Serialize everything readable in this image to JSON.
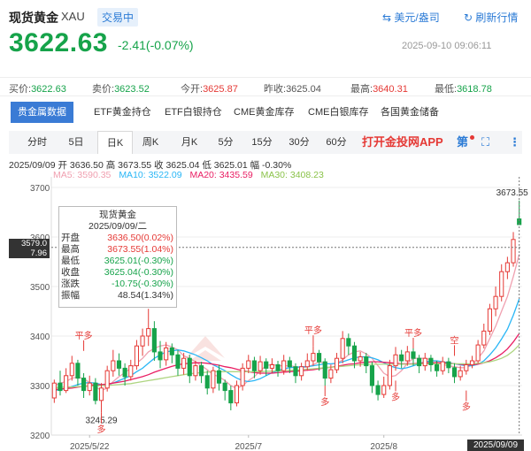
{
  "header": {
    "name": "现货黄金",
    "code": "XAU",
    "state": "交易中",
    "unit_toggle": "美元/盎司",
    "refresh": "刷新行情"
  },
  "price": {
    "last": "3622.63",
    "change": "-2.41(-0.07%)",
    "timestamp": "2025-09-10 09:06:11"
  },
  "quotes": {
    "buy_label": "买价:",
    "buy": "3622.63",
    "sell_label": "卖价:",
    "sell": "3623.52",
    "open_label": "今开:",
    "open": "3625.87",
    "prev_label": "昨收:",
    "prev": "3625.04",
    "high_label": "最高:",
    "high": "3640.31",
    "low_label": "最低:",
    "low": "3618.78"
  },
  "subtabs": [
    "贵金属数据",
    "ETF黄金持仓",
    "ETF白银持仓",
    "CME黄金库存",
    "CME白银库存",
    "各国黄金储备"
  ],
  "periods": [
    "分时",
    "5日",
    "日K",
    "周K",
    "月K",
    "5分",
    "15分",
    "30分",
    "60分"
  ],
  "app_promo": "打开金投网APP",
  "toolbar": {
    "indicator": "第"
  },
  "ohlc_line": "2025/09/09 开 3636.50 高 3673.55 收 3625.04 低 3625.01 幅 -0.30%",
  "ma_line": [
    {
      "label": "MA5: 3590.35",
      "color": "#f0a0b0"
    },
    {
      "label": "MA10: 3522.09",
      "color": "#29b6f6"
    },
    {
      "label": "MA20: 3435.59",
      "color": "#e91e63"
    },
    {
      "label": "MA30: 3408.23",
      "color": "#aed581"
    }
  ],
  "tooltip": {
    "title": "现货黄金",
    "date": "2025/09/09/二",
    "rows": [
      {
        "k": "开盘",
        "v": "3636.50(0.02%)",
        "color": "#e53935"
      },
      {
        "k": "最高",
        "v": "3673.55(1.04%)",
        "color": "#e53935"
      },
      {
        "k": "最低",
        "v": "3625.01(-0.30%)",
        "color": "#16a34a"
      },
      {
        "k": "收盘",
        "v": "3625.04(-0.30%)",
        "color": "#16a34a"
      },
      {
        "k": "涨跌",
        "v": "-10.75(-0.30%)",
        "color": "#16a34a"
      },
      {
        "k": "振幅",
        "v": "48.54(1.34%)",
        "color": "#333333"
      }
    ]
  },
  "crosshair": {
    "price_tag": "3579.0",
    "price_tag2": "7.96",
    "date_tag": "2025/09/09"
  },
  "chart_data": {
    "type": "candlestick",
    "ylim": [
      3200,
      3700
    ],
    "yticks": [
      3200,
      3300,
      3400,
      3500,
      3600,
      3700
    ],
    "xtick_labels": [
      {
        "label": "2025/5/22",
        "index": 6
      },
      {
        "label": "2025/7",
        "index": 33
      },
      {
        "label": "2025/8",
        "index": 56
      }
    ],
    "annotations": [
      {
        "text": "3673.55",
        "index": 79,
        "value": 3673.55
      },
      {
        "text": "3245.29",
        "index": 8,
        "value": 3245.29
      },
      {
        "text": "平多",
        "index": 5,
        "value": 3370
      },
      {
        "text": "多",
        "index": 8,
        "value": 3245
      },
      {
        "text": "平多",
        "index": 44,
        "value": 3380
      },
      {
        "text": "多",
        "index": 46,
        "value": 3300
      },
      {
        "text": "平多",
        "index": 61,
        "value": 3375
      },
      {
        "text": "多",
        "index": 58,
        "value": 3310
      },
      {
        "text": "空",
        "index": 68,
        "value": 3360
      },
      {
        "text": "多",
        "index": 70,
        "value": 3290
      }
    ],
    "candles": [
      [
        3275,
        3305,
        3265,
        3312
      ],
      [
        3305,
        3290,
        3280,
        3330
      ],
      [
        3290,
        3320,
        3285,
        3335
      ],
      [
        3320,
        3345,
        3310,
        3360
      ],
      [
        3345,
        3315,
        3300,
        3352
      ],
      [
        3315,
        3290,
        3275,
        3325
      ],
      [
        3290,
        3305,
        3280,
        3320
      ],
      [
        3305,
        3270,
        3262,
        3315
      ],
      [
        3270,
        3295,
        3245,
        3305
      ],
      [
        3295,
        3330,
        3288,
        3340
      ],
      [
        3330,
        3350,
        3318,
        3372
      ],
      [
        3350,
        3335,
        3320,
        3365
      ],
      [
        3335,
        3318,
        3300,
        3345
      ],
      [
        3318,
        3340,
        3310,
        3352
      ],
      [
        3340,
        3380,
        3332,
        3392
      ],
      [
        3380,
        3400,
        3360,
        3415
      ],
      [
        3400,
        3415,
        3380,
        3455
      ],
      [
        3415,
        3368,
        3350,
        3430
      ],
      [
        3368,
        3352,
        3335,
        3390
      ],
      [
        3352,
        3376,
        3340,
        3388
      ],
      [
        3376,
        3362,
        3345,
        3385
      ],
      [
        3362,
        3335,
        3320,
        3372
      ],
      [
        3335,
        3355,
        3322,
        3366
      ],
      [
        3355,
        3320,
        3305,
        3362
      ],
      [
        3320,
        3340,
        3310,
        3350
      ],
      [
        3340,
        3320,
        3305,
        3348
      ],
      [
        3320,
        3295,
        3282,
        3330
      ],
      [
        3295,
        3330,
        3285,
        3338
      ],
      [
        3330,
        3305,
        3290,
        3342
      ],
      [
        3305,
        3290,
        3270,
        3312
      ],
      [
        3290,
        3265,
        3250,
        3300
      ],
      [
        3265,
        3300,
        3258,
        3310
      ],
      [
        3300,
        3335,
        3290,
        3345
      ],
      [
        3335,
        3350,
        3325,
        3362
      ],
      [
        3350,
        3330,
        3315,
        3358
      ],
      [
        3330,
        3348,
        3322,
        3360
      ],
      [
        3348,
        3335,
        3320,
        3355
      ],
      [
        3335,
        3342,
        3325,
        3355
      ],
      [
        3342,
        3330,
        3318,
        3350
      ],
      [
        3330,
        3350,
        3322,
        3362
      ],
      [
        3350,
        3338,
        3325,
        3358
      ],
      [
        3338,
        3320,
        3305,
        3345
      ],
      [
        3320,
        3338,
        3310,
        3346
      ],
      [
        3338,
        3350,
        3330,
        3365
      ],
      [
        3350,
        3365,
        3340,
        3380
      ],
      [
        3365,
        3348,
        3330,
        3372
      ],
      [
        3348,
        3315,
        3300,
        3355
      ],
      [
        3315,
        3332,
        3305,
        3342
      ],
      [
        3332,
        3355,
        3325,
        3366
      ],
      [
        3355,
        3395,
        3345,
        3410
      ],
      [
        3395,
        3380,
        3362,
        3405
      ],
      [
        3380,
        3350,
        3335,
        3388
      ],
      [
        3350,
        3358,
        3338,
        3368
      ],
      [
        3358,
        3340,
        3325,
        3366
      ],
      [
        3340,
        3300,
        3285,
        3348
      ],
      [
        3300,
        3282,
        3270,
        3310
      ],
      [
        3282,
        3300,
        3275,
        3318
      ],
      [
        3300,
        3340,
        3292,
        3352
      ],
      [
        3340,
        3362,
        3330,
        3378
      ],
      [
        3362,
        3350,
        3335,
        3372
      ],
      [
        3350,
        3368,
        3340,
        3380
      ],
      [
        3368,
        3355,
        3340,
        3376
      ],
      [
        3355,
        3340,
        3325,
        3362
      ],
      [
        3340,
        3355,
        3330,
        3366
      ],
      [
        3355,
        3342,
        3328,
        3362
      ],
      [
        3342,
        3330,
        3318,
        3350
      ],
      [
        3330,
        3348,
        3322,
        3358
      ],
      [
        3348,
        3336,
        3325,
        3356
      ],
      [
        3336,
        3318,
        3305,
        3345
      ],
      [
        3318,
        3330,
        3310,
        3340
      ],
      [
        3330,
        3342,
        3322,
        3352
      ],
      [
        3342,
        3350,
        3335,
        3360
      ],
      [
        3350,
        3382,
        3345,
        3392
      ],
      [
        3382,
        3410,
        3375,
        3425
      ],
      [
        3410,
        3455,
        3402,
        3465
      ],
      [
        3455,
        3480,
        3440,
        3500
      ],
      [
        3480,
        3530,
        3470,
        3545
      ],
      [
        3530,
        3548,
        3515,
        3560
      ],
      [
        3548,
        3595,
        3540,
        3610
      ],
      [
        3636.5,
        3625.04,
        3625.01,
        3673.55
      ]
    ],
    "ma_series": [
      {
        "name": "MA5",
        "color": "#f0a0b0",
        "values": [
          3300,
          3305,
          3308,
          3315,
          3317,
          3314,
          3306,
          3298,
          3290,
          3295,
          3308,
          3318,
          3326,
          3335,
          3345,
          3355,
          3368,
          3375,
          3380,
          3382,
          3378,
          3372,
          3360,
          3355,
          3348,
          3340,
          3332,
          3322,
          3318,
          3310,
          3300,
          3294,
          3300,
          3310,
          3318,
          3330,
          3340,
          3343,
          3340,
          3340,
          3340,
          3338,
          3336,
          3338,
          3342,
          3348,
          3345,
          3343,
          3345,
          3352,
          3362,
          3368,
          3370,
          3364,
          3355,
          3340,
          3325,
          3318,
          3320,
          3330,
          3345,
          3355,
          3355,
          3355,
          3352,
          3348,
          3342,
          3340,
          3338,
          3336,
          3336,
          3342,
          3355,
          3370,
          3395,
          3420,
          3450,
          3480,
          3520,
          3565
        ]
      },
      {
        "name": "MA10",
        "color": "#29b6f6",
        "values": [
          3290,
          3292,
          3294,
          3298,
          3302,
          3305,
          3306,
          3305,
          3302,
          3302,
          3305,
          3310,
          3315,
          3320,
          3328,
          3335,
          3345,
          3355,
          3362,
          3368,
          3370,
          3372,
          3370,
          3366,
          3362,
          3356,
          3350,
          3342,
          3336,
          3330,
          3322,
          3315,
          3310,
          3308,
          3310,
          3314,
          3320,
          3326,
          3330,
          3334,
          3336,
          3337,
          3338,
          3338,
          3340,
          3342,
          3344,
          3344,
          3345,
          3348,
          3352,
          3356,
          3358,
          3358,
          3356,
          3352,
          3346,
          3340,
          3336,
          3334,
          3336,
          3340,
          3344,
          3348,
          3350,
          3350,
          3348,
          3346,
          3344,
          3342,
          3340,
          3340,
          3343,
          3350,
          3362,
          3376,
          3394,
          3414,
          3442,
          3475
        ]
      },
      {
        "name": "MA20",
        "color": "#e91e63",
        "values": [
          3292,
          3293,
          3294,
          3295,
          3297,
          3298,
          3300,
          3301,
          3302,
          3303,
          3305,
          3307,
          3309,
          3312,
          3315,
          3318,
          3322,
          3327,
          3331,
          3335,
          3339,
          3342,
          3344,
          3345,
          3346,
          3346,
          3345,
          3343,
          3341,
          3338,
          3336,
          3333,
          3330,
          3328,
          3326,
          3325,
          3325,
          3325,
          3326,
          3327,
          3328,
          3329,
          3330,
          3331,
          3332,
          3334,
          3336,
          3337,
          3339,
          3341,
          3343,
          3344,
          3346,
          3347,
          3348,
          3348,
          3347,
          3346,
          3345,
          3344,
          3344,
          3344,
          3345,
          3346,
          3346,
          3346,
          3346,
          3345,
          3344,
          3343,
          3342,
          3342,
          3343,
          3346,
          3350,
          3356,
          3364,
          3374,
          3388,
          3405
        ]
      },
      {
        "name": "MA30",
        "color": "#aed581",
        "values": [
          3296,
          3296,
          3297,
          3297,
          3298,
          3298,
          3299,
          3299,
          3300,
          3300,
          3301,
          3302,
          3303,
          3304,
          3306,
          3308,
          3310,
          3312,
          3314,
          3316,
          3318,
          3320,
          3322,
          3324,
          3325,
          3326,
          3327,
          3328,
          3328,
          3328,
          3328,
          3328,
          3328,
          3328,
          3328,
          3328,
          3329,
          3329,
          3330,
          3330,
          3331,
          3331,
          3332,
          3333,
          3334,
          3335,
          3336,
          3337,
          3338,
          3339,
          3340,
          3341,
          3342,
          3343,
          3343,
          3343,
          3343,
          3343,
          3343,
          3343,
          3343,
          3343,
          3344,
          3344,
          3344,
          3344,
          3344,
          3344,
          3344,
          3344,
          3344,
          3344,
          3345,
          3346,
          3348,
          3351,
          3355,
          3361,
          3370,
          3382
        ]
      }
    ]
  }
}
